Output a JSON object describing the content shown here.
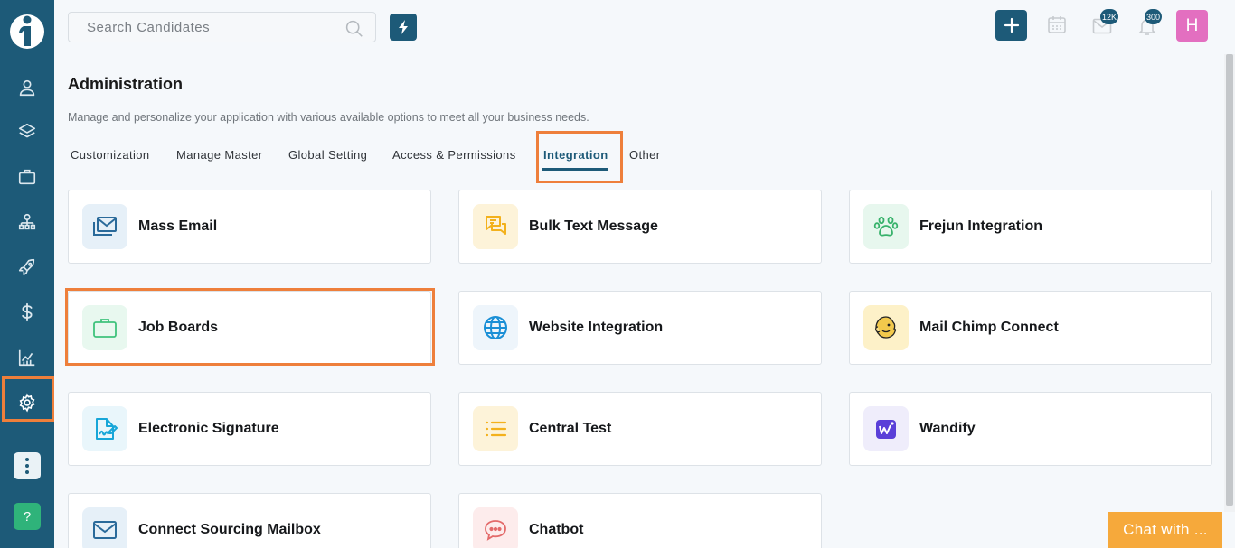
{
  "search": {
    "placeholder": "Search Candidates"
  },
  "header": {
    "mail_badge": "12K",
    "notif_badge": "300",
    "avatar_initial": "H"
  },
  "page": {
    "title": "Administration",
    "subtitle": "Manage and personalize your application with various available options to meet all your business needs."
  },
  "tabs": [
    {
      "label": "Customization"
    },
    {
      "label": "Manage Master"
    },
    {
      "label": "Global Setting"
    },
    {
      "label": "Access & Permissions"
    },
    {
      "label": "Integration",
      "active": true
    },
    {
      "label": "Other"
    }
  ],
  "cards": [
    {
      "label": "Mass Email",
      "icon": "mail-stack-icon"
    },
    {
      "label": "Bulk Text Message",
      "icon": "chat-bubbles-icon"
    },
    {
      "label": "Frejun Integration",
      "icon": "paw-icon"
    },
    {
      "label": "Job Boards",
      "icon": "briefcase-icon"
    },
    {
      "label": "Website Integration",
      "icon": "globe-icon"
    },
    {
      "label": "Mail Chimp Connect",
      "icon": "mailchimp-icon"
    },
    {
      "label": "Electronic Signature",
      "icon": "signature-icon"
    },
    {
      "label": "Central Test",
      "icon": "list-icon"
    },
    {
      "label": "Wandify",
      "icon": "wandify-icon"
    },
    {
      "label": "Connect Sourcing Mailbox",
      "icon": "envelope-icon"
    },
    {
      "label": "Chatbot",
      "icon": "chatbot-icon"
    }
  ],
  "chat_widget": {
    "label": "Chat with ..."
  },
  "help_label": "?",
  "colors": {
    "sidebar": "#1d5a78",
    "highlight": "#ee7f3b",
    "chat": "#f6a93b",
    "avatar": "#e36fc0"
  }
}
